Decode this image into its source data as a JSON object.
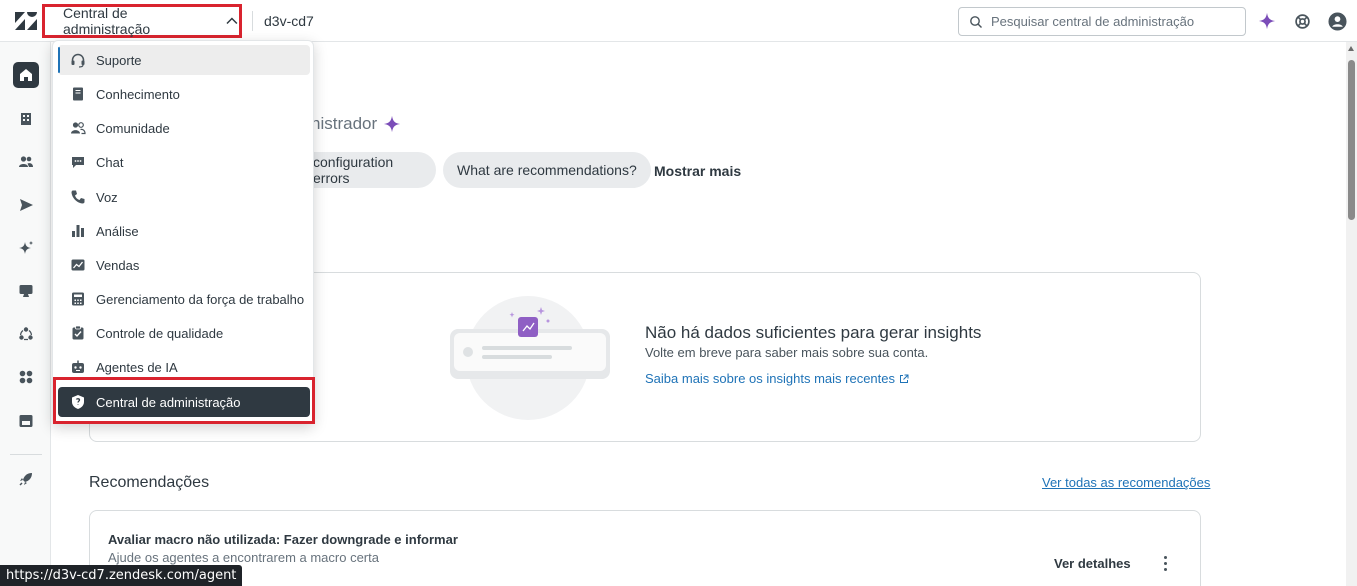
{
  "topbar": {
    "product_switcher_label": "Central de administração",
    "subdomain": "d3v-cd7",
    "search_placeholder": "Pesquisar central de administração"
  },
  "main": {
    "hero_title": "nistrador",
    "chips": [
      "configuration errors",
      "What are recommendations?"
    ],
    "show_more": "Mostrar mais",
    "insights": {
      "title": "Não há dados suficientes para gerar insights",
      "subtitle": "Volte em breve para saber mais sobre sua conta.",
      "link": "Saiba mais sobre os insights mais recentes"
    },
    "recommendations": {
      "title": "Recomendações",
      "view_all": "Ver todas as recomendações",
      "card_title": "Avaliar macro não utilizada: Fazer downgrade e informar",
      "card_subtitle": "Ajude os agentes a encontrarem a macro certa",
      "card_action": "Ver detalhes"
    }
  },
  "menu": {
    "items": [
      {
        "label": "Suporte",
        "icon": "headset-icon"
      },
      {
        "label": "Conhecimento",
        "icon": "book-icon"
      },
      {
        "label": "Comunidade",
        "icon": "people-icon"
      },
      {
        "label": "Chat",
        "icon": "chat-icon"
      },
      {
        "label": "Voz",
        "icon": "phone-icon"
      },
      {
        "label": "Análise",
        "icon": "bar-chart-icon"
      },
      {
        "label": "Vendas",
        "icon": "trend-icon"
      },
      {
        "label": "Gerenciamento da força de trabalho",
        "icon": "calculator-icon"
      },
      {
        "label": "Controle de qualidade",
        "icon": "clipboard-check-icon"
      },
      {
        "label": "Agentes de IA",
        "icon": "robot-icon"
      },
      {
        "label": "Central de administração",
        "icon": "shield-icon"
      }
    ]
  },
  "statusbar": {
    "url": "https://d3v-cd7.zendesk.com/agent"
  },
  "colors": {
    "accent_red": "#d9232e",
    "link_blue": "#1f73b7",
    "dark": "#2f3941",
    "sparkle_purple": "#7b4db8"
  }
}
